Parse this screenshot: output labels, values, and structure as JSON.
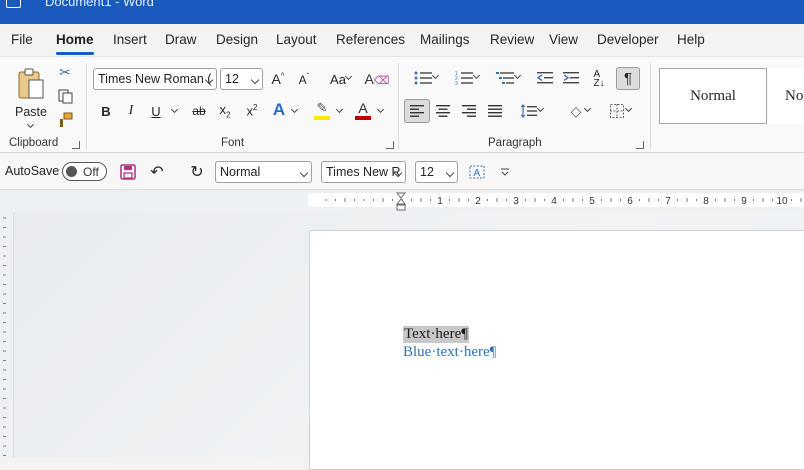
{
  "window": {
    "title": "Document1  -  Word"
  },
  "tabs": [
    "File",
    "Home",
    "Insert",
    "Draw",
    "Design",
    "Layout",
    "References",
    "Mailings",
    "Review",
    "View",
    "Developer",
    "Help"
  ],
  "clipboard": {
    "paste_label": "Paste",
    "group_label": "Clipboard"
  },
  "font": {
    "name": "Times New Roman (",
    "size": "12",
    "group_label": "Font"
  },
  "paragraph": {
    "group_label": "Paragraph"
  },
  "styles": {
    "normal": "Normal",
    "next": "No"
  },
  "qat": {
    "autosave_label": "AutoSave",
    "autosave_state": "Off",
    "style_value": "Normal",
    "font_value": "Times New R",
    "size_value": "12"
  },
  "ruler": {
    "labels": [
      "1",
      "2",
      "3",
      "4",
      "5",
      "6",
      "7",
      "8",
      "9",
      "10"
    ]
  },
  "document": {
    "line1": "Text·here¶",
    "line2": "Blue·text·here¶",
    "line2_color": "#2e74b5"
  },
  "colors": {
    "accent": "#185abd",
    "highlight": "#ffe600",
    "font_color": "#c00000"
  }
}
